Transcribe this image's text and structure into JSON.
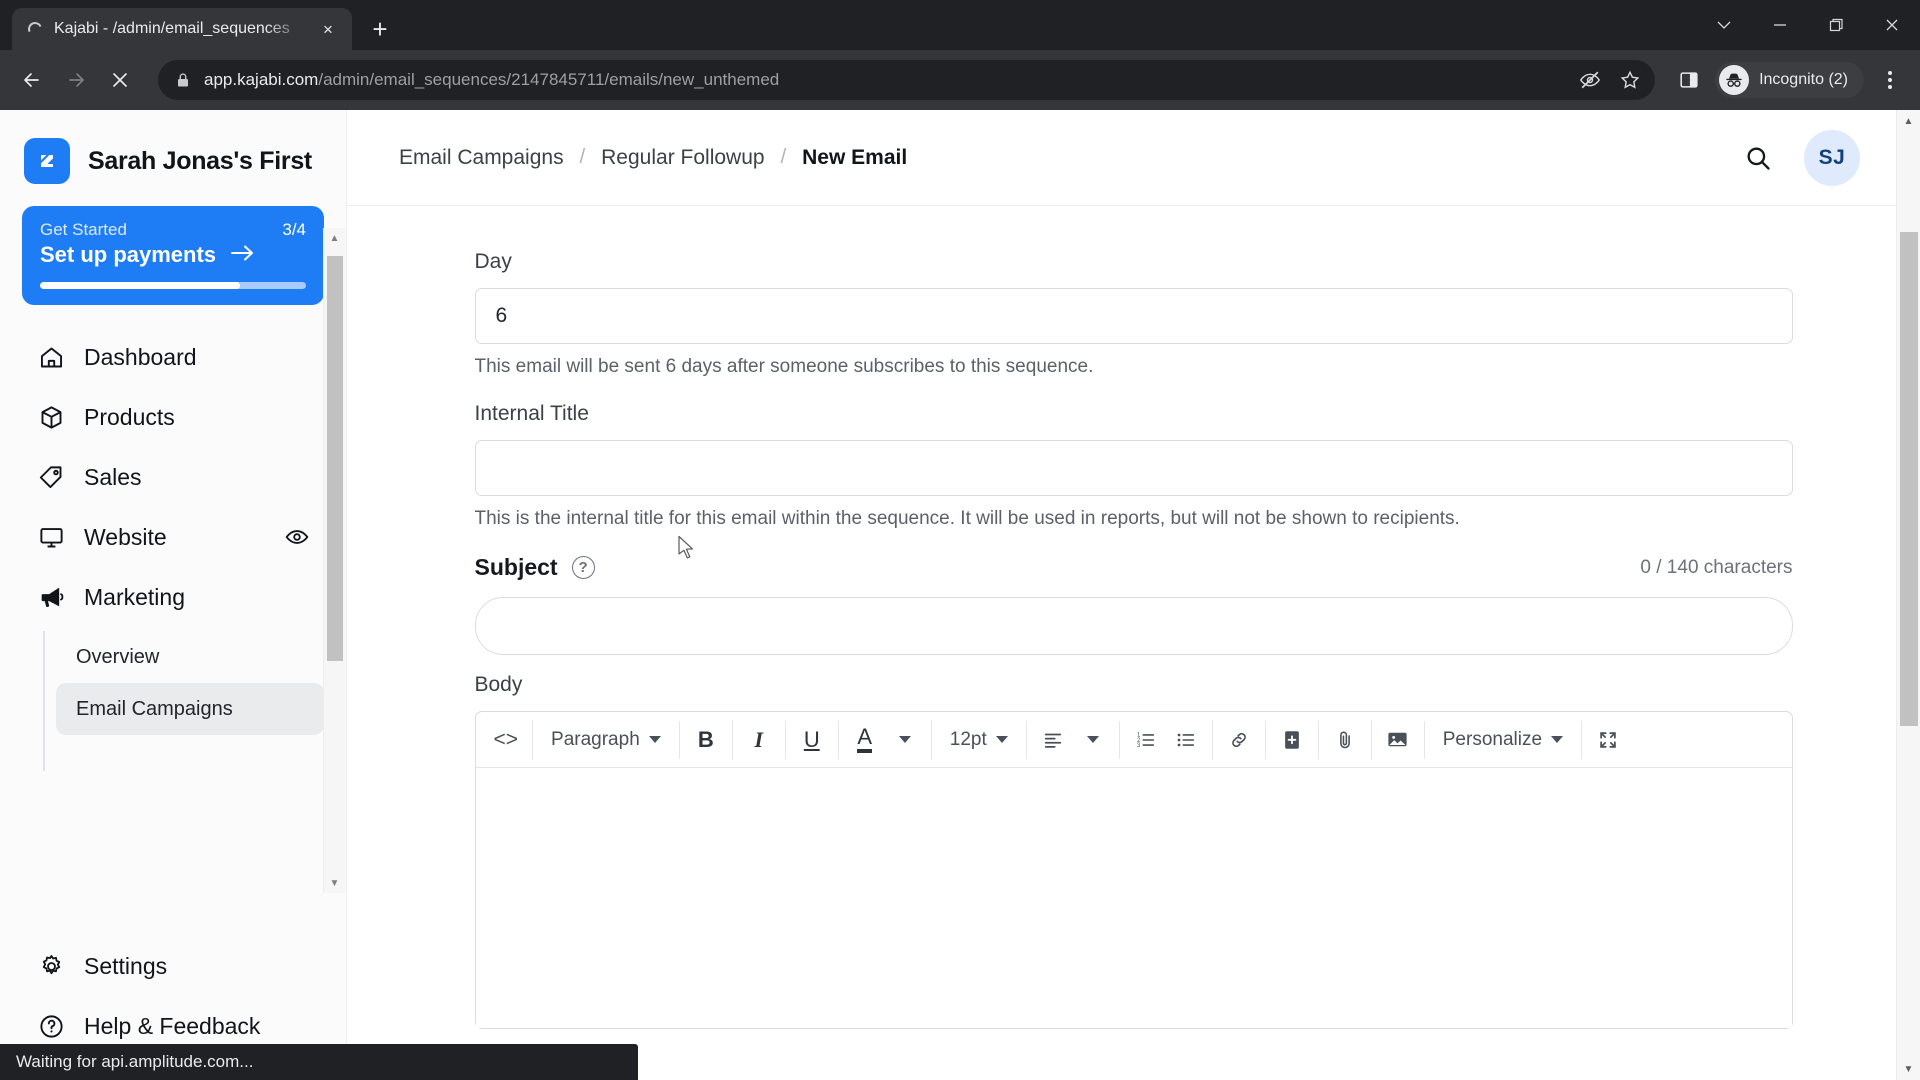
{
  "browser": {
    "tab": {
      "title": "Kajabi - /admin/email_sequences",
      "favicon": "loading-spinner-icon",
      "close": "×"
    },
    "new_tab_label": "+",
    "window_controls": {
      "minimize": "—",
      "maximize": "❐",
      "close": "✕",
      "dropdown": "∨"
    },
    "url": {
      "host": "app.kajabi.com",
      "path": "/admin/email_sequences/2147845711/emails/new_unthemed"
    },
    "profile_label": "Incognito (2)",
    "icons": {
      "back": "back-arrow-icon",
      "forward": "forward-arrow-icon",
      "stop": "stop-loading-icon",
      "lock": "lock-icon",
      "tracking_protection": "eye-slash-icon",
      "bookmark": "star-icon",
      "side_panel": "side-panel-icon",
      "incognito": "incognito-hat-icon",
      "menu": "three-dot-menu-icon"
    }
  },
  "sidebar": {
    "brand": {
      "name": "Sarah Jonas's First",
      "logo": "kajabi-logo-icon"
    },
    "get_started": {
      "label": "Get Started",
      "count": "3/4",
      "cta": "Set up payments",
      "arrow": "arrow-right-icon",
      "progress_percent": 75
    },
    "items": [
      {
        "label": "Dashboard",
        "icon": "home-icon"
      },
      {
        "label": "Products",
        "icon": "box-icon"
      },
      {
        "label": "Sales",
        "icon": "tag-icon"
      },
      {
        "label": "Website",
        "icon": "monitor-icon",
        "trailing_icon": "eye-icon"
      },
      {
        "label": "Marketing",
        "icon": "megaphone-icon",
        "expanded": true
      }
    ],
    "marketing_subitems": [
      {
        "label": "Overview",
        "active": false
      },
      {
        "label": "Email Campaigns",
        "active": true
      }
    ],
    "bottom_items": [
      {
        "label": "Settings",
        "icon": "gear-icon"
      },
      {
        "label": "Help & Feedback",
        "icon": "question-circle-icon"
      }
    ]
  },
  "topbar": {
    "breadcrumb": [
      {
        "label": "Email Campaigns",
        "current": false
      },
      {
        "label": "Regular Followup",
        "current": false
      },
      {
        "label": "New Email",
        "current": true
      }
    ],
    "separator": "/",
    "search_icon": "search-icon",
    "avatar_initials": "SJ"
  },
  "form": {
    "day": {
      "label": "Day",
      "value": "6",
      "placeholder": "",
      "help": "This email will be sent 6 days after someone subscribes to this sequence."
    },
    "internal_title": {
      "label": "Internal Title",
      "value": "",
      "placeholder": "",
      "help": "This is the internal title for this email within the sequence. It will be used in reports, but will not be shown to recipients."
    },
    "subject": {
      "label": "Subject",
      "help_icon": "question-mark-icon",
      "char_count": "0 / 140 characters",
      "value": "",
      "placeholder": ""
    },
    "body": {
      "label": "Body",
      "value": "",
      "toolbar": {
        "source_code": "<>",
        "block_format": "Paragraph",
        "bold": "B",
        "italic": "I",
        "underline": "U",
        "text_color": "A",
        "font_size": "12pt",
        "align_icon": "align-left-icon",
        "numbered_list_icon": "numbered-list-icon",
        "bullet_list_icon": "bullet-list-icon",
        "link_icon": "link-icon",
        "insert_icon": "plus-box-icon",
        "attachment_icon": "paperclip-icon",
        "image_icon": "image-icon",
        "personalize": "Personalize",
        "fullscreen_icon": "fullscreen-icon"
      }
    }
  },
  "status_bar": {
    "text": "Waiting for api.amplitude.com..."
  },
  "colors": {
    "accent_blue": "#1e7df5",
    "chrome_dark": "#202124",
    "chrome_toolbar": "#35363a",
    "sidebar_bg": "#fbfbfc",
    "avatar_bg": "#dfeafc",
    "avatar_text": "#13417e"
  }
}
